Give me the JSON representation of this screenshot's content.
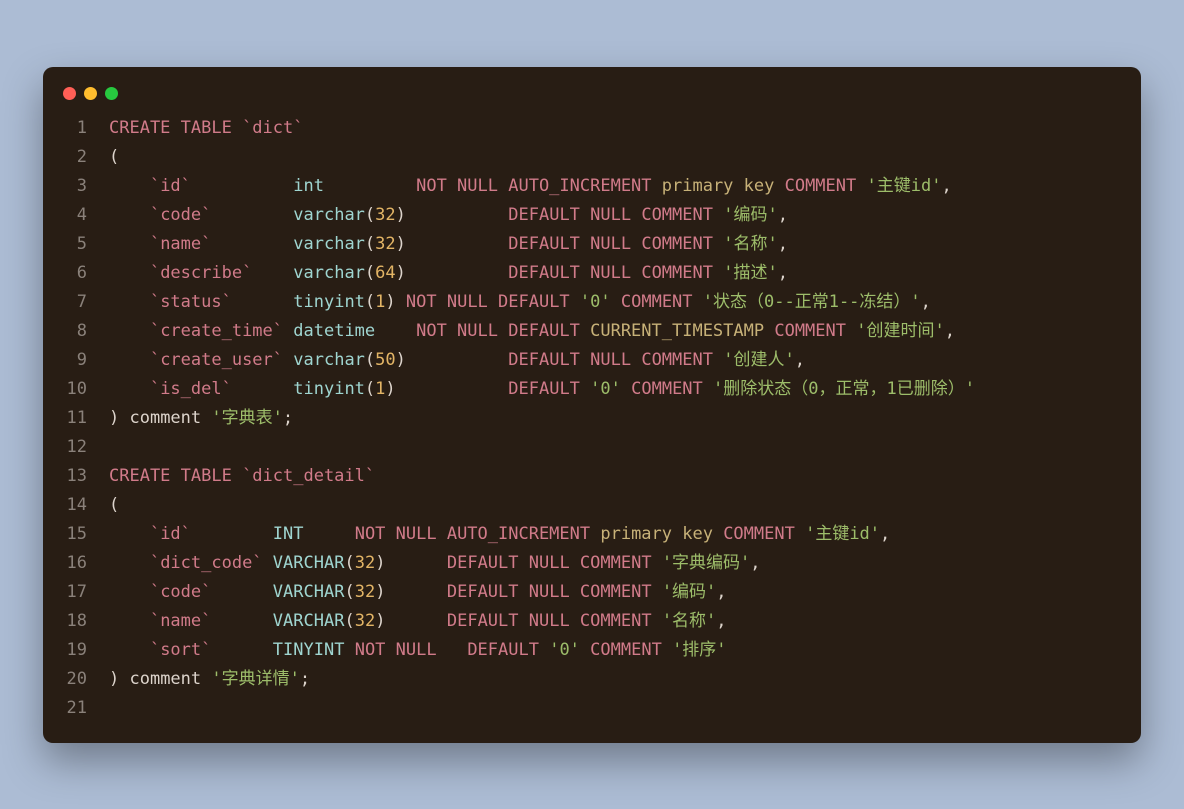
{
  "titlebar": {
    "red": "#ff5f56",
    "yellow": "#ffbd2e",
    "green": "#27c93f"
  },
  "lines": {
    "l1": [
      [
        "kw",
        "CREATE TABLE "
      ],
      [
        "bt",
        "`dict`"
      ]
    ],
    "l2": [
      [
        "p",
        "("
      ]
    ],
    "l3": [
      [
        "p",
        "    "
      ],
      [
        "bt",
        "`id`"
      ],
      [
        "p",
        "          "
      ],
      [
        "type",
        "int"
      ],
      [
        "p",
        "         "
      ],
      [
        "kw",
        "NOT NULL "
      ],
      [
        "kw",
        "AUTO_INCREMENT "
      ],
      [
        "pk",
        "primary key "
      ],
      [
        "kw",
        "COMMENT "
      ],
      [
        "str",
        "'主键id'"
      ],
      [
        "p",
        ","
      ]
    ],
    "l4": [
      [
        "p",
        "    "
      ],
      [
        "bt",
        "`code`"
      ],
      [
        "p",
        "        "
      ],
      [
        "type",
        "varchar"
      ],
      [
        "p",
        "("
      ],
      [
        "num",
        "32"
      ],
      [
        "p",
        ")"
      ],
      [
        "p",
        "          "
      ],
      [
        "kw",
        "DEFAULT NULL "
      ],
      [
        "kw",
        "COMMENT "
      ],
      [
        "str",
        "'编码'"
      ],
      [
        "p",
        ","
      ]
    ],
    "l5": [
      [
        "p",
        "    "
      ],
      [
        "bt",
        "`name`"
      ],
      [
        "p",
        "        "
      ],
      [
        "type",
        "varchar"
      ],
      [
        "p",
        "("
      ],
      [
        "num",
        "32"
      ],
      [
        "p",
        ")"
      ],
      [
        "p",
        "          "
      ],
      [
        "kw",
        "DEFAULT NULL "
      ],
      [
        "kw",
        "COMMENT "
      ],
      [
        "str",
        "'名称'"
      ],
      [
        "p",
        ","
      ]
    ],
    "l6": [
      [
        "p",
        "    "
      ],
      [
        "bt",
        "`describe`"
      ],
      [
        "p",
        "    "
      ],
      [
        "type",
        "varchar"
      ],
      [
        "p",
        "("
      ],
      [
        "num",
        "64"
      ],
      [
        "p",
        ")"
      ],
      [
        "p",
        "          "
      ],
      [
        "kw",
        "DEFAULT NULL "
      ],
      [
        "kw",
        "COMMENT "
      ],
      [
        "str",
        "'描述'"
      ],
      [
        "p",
        ","
      ]
    ],
    "l7": [
      [
        "p",
        "    "
      ],
      [
        "bt",
        "`status`"
      ],
      [
        "p",
        "      "
      ],
      [
        "type",
        "tinyint"
      ],
      [
        "p",
        "("
      ],
      [
        "num",
        "1"
      ],
      [
        "p",
        ") "
      ],
      [
        "kw",
        "NOT NULL DEFAULT "
      ],
      [
        "str",
        "'0'"
      ],
      [
        "p",
        " "
      ],
      [
        "kw",
        "COMMENT "
      ],
      [
        "str",
        "'状态（0--正常1--冻结）'"
      ],
      [
        "p",
        ","
      ]
    ],
    "l8": [
      [
        "p",
        "    "
      ],
      [
        "bt",
        "`create_time`"
      ],
      [
        "p",
        " "
      ],
      [
        "type",
        "datetime"
      ],
      [
        "p",
        "    "
      ],
      [
        "kw",
        "NOT NULL DEFAULT "
      ],
      [
        "fn",
        "CURRENT_TIMESTAMP "
      ],
      [
        "kw",
        "COMMENT "
      ],
      [
        "str",
        "'创建时间'"
      ],
      [
        "p",
        ","
      ]
    ],
    "l9": [
      [
        "p",
        "    "
      ],
      [
        "bt",
        "`create_user`"
      ],
      [
        "p",
        " "
      ],
      [
        "type",
        "varchar"
      ],
      [
        "p",
        "("
      ],
      [
        "num",
        "50"
      ],
      [
        "p",
        ")"
      ],
      [
        "p",
        "          "
      ],
      [
        "kw",
        "DEFAULT NULL "
      ],
      [
        "kw",
        "COMMENT "
      ],
      [
        "str",
        "'创建人'"
      ],
      [
        "p",
        ","
      ]
    ],
    "l10": [
      [
        "p",
        "    "
      ],
      [
        "bt",
        "`is_del`"
      ],
      [
        "p",
        "      "
      ],
      [
        "type",
        "tinyint"
      ],
      [
        "p",
        "("
      ],
      [
        "num",
        "1"
      ],
      [
        "p",
        ")"
      ],
      [
        "p",
        "           "
      ],
      [
        "kw",
        "DEFAULT "
      ],
      [
        "str",
        "'0'"
      ],
      [
        "p",
        " "
      ],
      [
        "kw",
        "COMMENT "
      ],
      [
        "str",
        "'删除状态（0，正常，1已删除）'"
      ]
    ],
    "l11": [
      [
        "p",
        ") "
      ],
      [
        "cmt",
        "comment "
      ],
      [
        "str",
        "'字典表'"
      ],
      [
        "p",
        ";"
      ]
    ],
    "l12": [],
    "l13": [
      [
        "kw",
        "CREATE TABLE "
      ],
      [
        "bt",
        "`dict_detail`"
      ]
    ],
    "l14": [
      [
        "p",
        "("
      ]
    ],
    "l15": [
      [
        "p",
        "    "
      ],
      [
        "bt",
        "`id`"
      ],
      [
        "p",
        "        "
      ],
      [
        "type",
        "INT"
      ],
      [
        "p",
        "     "
      ],
      [
        "kw",
        "NOT NULL "
      ],
      [
        "kw",
        "AUTO_INCREMENT "
      ],
      [
        "pk",
        "primary key "
      ],
      [
        "kw",
        "COMMENT "
      ],
      [
        "str",
        "'主键id'"
      ],
      [
        "p",
        ","
      ]
    ],
    "l16": [
      [
        "p",
        "    "
      ],
      [
        "bt",
        "`dict_code`"
      ],
      [
        "p",
        " "
      ],
      [
        "type",
        "VARCHAR"
      ],
      [
        "p",
        "("
      ],
      [
        "num",
        "32"
      ],
      [
        "p",
        ")"
      ],
      [
        "p",
        "      "
      ],
      [
        "kw",
        "DEFAULT NULL "
      ],
      [
        "kw",
        "COMMENT "
      ],
      [
        "str",
        "'字典编码'"
      ],
      [
        "p",
        ","
      ]
    ],
    "l17": [
      [
        "p",
        "    "
      ],
      [
        "bt",
        "`code`"
      ],
      [
        "p",
        "      "
      ],
      [
        "type",
        "VARCHAR"
      ],
      [
        "p",
        "("
      ],
      [
        "num",
        "32"
      ],
      [
        "p",
        ")"
      ],
      [
        "p",
        "      "
      ],
      [
        "kw",
        "DEFAULT NULL "
      ],
      [
        "kw",
        "COMMENT "
      ],
      [
        "str",
        "'编码'"
      ],
      [
        "p",
        ","
      ]
    ],
    "l18": [
      [
        "p",
        "    "
      ],
      [
        "bt",
        "`name`"
      ],
      [
        "p",
        "      "
      ],
      [
        "type",
        "VARCHAR"
      ],
      [
        "p",
        "("
      ],
      [
        "num",
        "32"
      ],
      [
        "p",
        ")"
      ],
      [
        "p",
        "      "
      ],
      [
        "kw",
        "DEFAULT NULL "
      ],
      [
        "kw",
        "COMMENT "
      ],
      [
        "str",
        "'名称'"
      ],
      [
        "p",
        ","
      ]
    ],
    "l19": [
      [
        "p",
        "    "
      ],
      [
        "bt",
        "`sort`"
      ],
      [
        "p",
        "      "
      ],
      [
        "type",
        "TINYINT"
      ],
      [
        "p",
        " "
      ],
      [
        "kw",
        "NOT NULL "
      ],
      [
        "p",
        "  "
      ],
      [
        "kw",
        "DEFAULT "
      ],
      [
        "str",
        "'0'"
      ],
      [
        "p",
        " "
      ],
      [
        "kw",
        "COMMENT "
      ],
      [
        "str",
        "'排序'"
      ]
    ],
    "l20": [
      [
        "p",
        ") "
      ],
      [
        "cmt",
        "comment "
      ],
      [
        "str",
        "'字典详情'"
      ],
      [
        "p",
        ";"
      ]
    ],
    "l21": []
  },
  "watermark": ""
}
